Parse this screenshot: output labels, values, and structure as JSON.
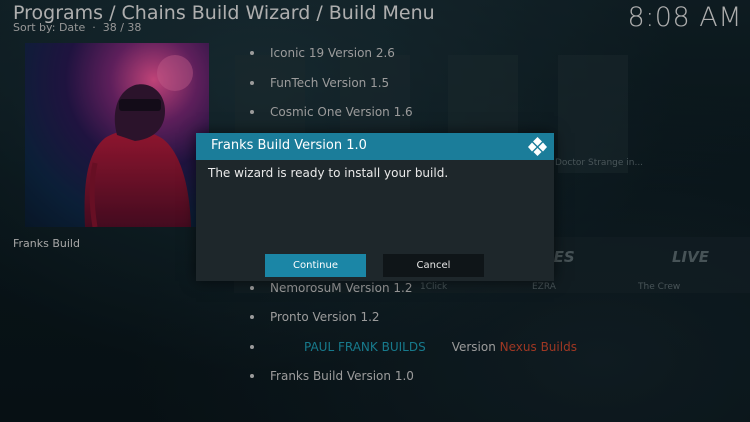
{
  "header": {
    "title": "Programs / Chains Build Wizard / Build Menu",
    "sort_label": "Sort by: Date",
    "count": "38 / 38",
    "clock": "8:08 AM"
  },
  "selected": {
    "label": "Franks Build"
  },
  "menu": {
    "items": [
      "Iconic 19 Version 2.6",
      "FunTech Version 1.5",
      "Cosmic One Version 1.6",
      "NemorosuM Version 1.2",
      "Pronto Version 1.2"
    ],
    "paul_frank": "PAUL FRANK BUILDS",
    "version_word": "Version",
    "nexus": "Nexus Builds",
    "last": "Franks Build Version 1.0"
  },
  "background": {
    "tile_caption": "Doctor Strange in...",
    "row_labels": [
      "1Click",
      "EZRA",
      "The Crew"
    ],
    "banner_words": [
      "IES",
      "LIVE"
    ]
  },
  "dialog": {
    "title": "Franks Build Version 1.0",
    "message": "The wizard is ready to install your build.",
    "continue_label": "Continue",
    "cancel_label": "Cancel"
  },
  "colors": {
    "accent": "#1b7d9a",
    "button_focus": "#1b86a6",
    "paul_frank": "#1fa3bb",
    "nexus": "#d44a2f"
  }
}
